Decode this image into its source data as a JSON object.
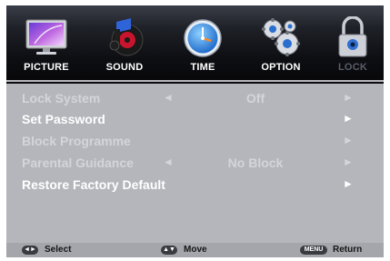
{
  "tabs": [
    {
      "label": "PICTURE",
      "icon": "monitor-icon"
    },
    {
      "label": "SOUND",
      "icon": "speaker-icon"
    },
    {
      "label": "TIME",
      "icon": "clock-icon"
    },
    {
      "label": "OPTION",
      "icon": "gears-icon"
    },
    {
      "label": "LOCK",
      "icon": "padlock-icon"
    }
  ],
  "active_tab": "LOCK",
  "menu": [
    {
      "label": "Lock System",
      "value": "Off",
      "left_arrow": "◄",
      "right_arrow": "►",
      "state": "disabled"
    },
    {
      "label": "Set Password",
      "value": "",
      "left_arrow": "",
      "right_arrow": "►",
      "state": "enabled"
    },
    {
      "label": "Block Programme",
      "value": "",
      "left_arrow": "",
      "right_arrow": "►",
      "state": "disabled"
    },
    {
      "label": "Parental Guidance",
      "value": "No Block",
      "left_arrow": "◄",
      "right_arrow": "►",
      "state": "disabled"
    },
    {
      "label": "Restore Factory Default",
      "value": "",
      "left_arrow": "",
      "right_arrow": "►",
      "state": "enabled"
    }
  ],
  "footer": {
    "select": {
      "key": "◄►",
      "label": "Select"
    },
    "move": {
      "key": "▲▼",
      "label": "Move"
    },
    "return": {
      "key": "MENU",
      "label": "Return"
    }
  },
  "colors": {
    "menu_bg": "#b4b6bb",
    "footer_bg": "#a4a6ab",
    "enabled_text": "#ffffff",
    "disabled_text": "#d4d5d8"
  }
}
